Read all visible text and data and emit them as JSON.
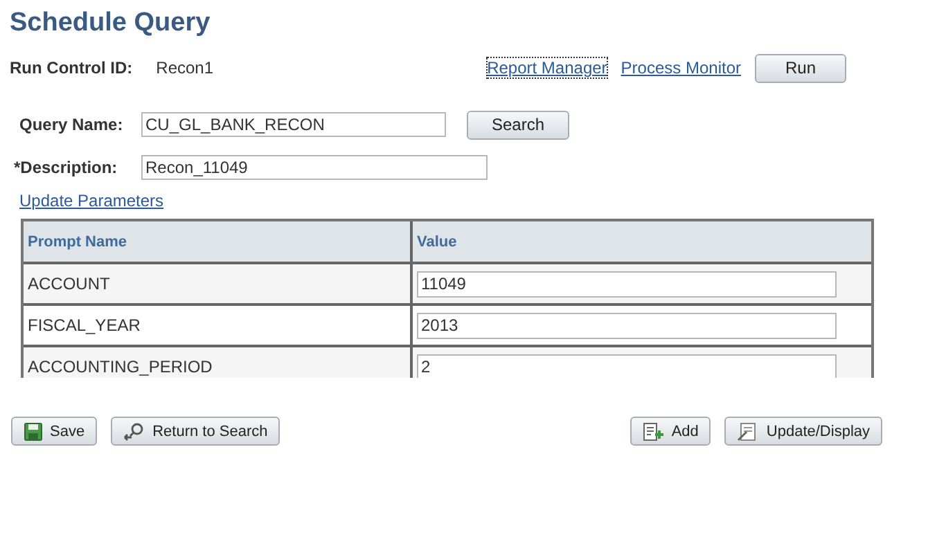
{
  "title": "Schedule Query",
  "run_control": {
    "label": "Run Control ID:",
    "value": "Recon1"
  },
  "top_links": [
    "Report Manager",
    "Process Monitor"
  ],
  "run_button": "Run",
  "query_name": {
    "label": "Query Name:",
    "value": "CU_GL_BANK_RECON"
  },
  "search_button": "Search",
  "description": {
    "label": "*Description:",
    "value": "Recon_11049"
  },
  "update_link": "Update Parameters",
  "table": {
    "columns": [
      "Prompt Name",
      "Value"
    ],
    "rows": [
      {
        "name": "ACCOUNT",
        "value": "11049"
      },
      {
        "name": "FISCAL_YEAR",
        "value": "2013"
      },
      {
        "name": "ACCOUNTING_PERIOD",
        "value": "2"
      }
    ]
  },
  "bottom_left": [
    {
      "kind": "save",
      "label": "Save"
    },
    {
      "kind": "return",
      "label": "Return to Search"
    }
  ],
  "bottom_right": [
    {
      "kind": "add",
      "label": "Add"
    },
    {
      "kind": "update",
      "label": "Update/Display"
    }
  ]
}
